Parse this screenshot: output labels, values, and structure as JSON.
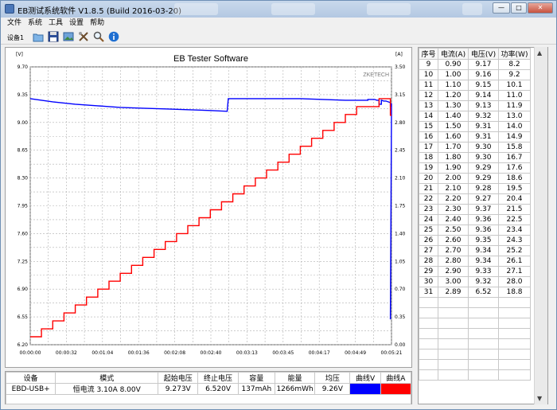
{
  "window": {
    "title": "EB测试系统软件 V1.8.5 (Build 2016-03-20)",
    "min_label": "—",
    "max_label": "□",
    "close_label": "✕"
  },
  "menu": [
    "文件",
    "系统",
    "工具",
    "设置",
    "帮助"
  ],
  "toolbar": {
    "device_label": "设备1",
    "icons": [
      "open-icon",
      "save-icon",
      "image-icon",
      "tools-icon",
      "zoom-icon",
      "info-icon"
    ]
  },
  "colors": {
    "voltage": "#0000ff",
    "current": "#ff0000",
    "grid": "#b0b0b0"
  },
  "chart_data": {
    "type": "line",
    "title": "EB Tester Software",
    "watermark": "ZKETECH",
    "left_unit": "[V]",
    "right_unit": "[A]",
    "y_left": {
      "ticks": [
        "9.70",
        "9.35",
        "9.00",
        "8.65",
        "8.30",
        "7.95",
        "7.60",
        "7.25",
        "6.90",
        "6.55",
        "6.20"
      ],
      "range": [
        6.2,
        9.7
      ]
    },
    "y_right": {
      "ticks": [
        "3.50",
        "3.15",
        "2.80",
        "2.45",
        "2.10",
        "1.75",
        "1.40",
        "1.05",
        "0.70",
        "0.35",
        "0.00"
      ],
      "range": [
        0.0,
        3.5
      ]
    },
    "x_ticks": [
      "00:00:00",
      "00:00:32",
      "00:01:04",
      "00:01:36",
      "00:02:08",
      "00:02:40",
      "00:03:13",
      "00:03:45",
      "00:04:17",
      "00:04:49",
      "00:05:21"
    ],
    "x_range_s": [
      0,
      321
    ],
    "series": [
      {
        "color": "#0000ff",
        "x": [
          0,
          10,
          20,
          40,
          60,
          80,
          100,
          120,
          140,
          160,
          175,
          176,
          200,
          240,
          260,
          280,
          300,
          310,
          312,
          300,
          304,
          306,
          308,
          310,
          312,
          314,
          316,
          318,
          320,
          321,
          310,
          320,
          321
        ],
        "y": [
          9.3,
          9.28,
          9.26,
          9.23,
          9.21,
          9.19,
          9.18,
          9.17,
          9.16,
          9.15,
          9.14,
          9.3,
          9.3,
          9.3,
          9.29,
          9.28,
          9.28,
          9.28,
          9.23,
          9.29,
          9.29,
          9.29,
          9.28,
          9.28,
          9.28,
          9.27,
          9.27,
          9.26,
          9.25,
          9.24,
          9.23,
          9.2,
          9.15
        ]
      },
      {
        "color": "#ff0000",
        "x": [
          0,
          10,
          20,
          30,
          40,
          50,
          60,
          70,
          80,
          90,
          100,
          110,
          120,
          130,
          140,
          150,
          160,
          170,
          180,
          190,
          200,
          210,
          220,
          230,
          240,
          250,
          260,
          270,
          280,
          290,
          300,
          310,
          320
        ],
        "y": [
          0.1,
          0.2,
          0.3,
          0.4,
          0.5,
          0.6,
          0.7,
          0.8,
          0.9,
          1.0,
          1.1,
          1.2,
          1.3,
          1.4,
          1.5,
          1.6,
          1.7,
          1.8,
          1.9,
          2.0,
          2.1,
          2.2,
          2.3,
          2.4,
          2.5,
          2.6,
          2.7,
          2.8,
          2.9,
          3.0,
          3.0,
          3.1,
          2.89
        ]
      }
    ]
  },
  "readings": {
    "headers": [
      "序号",
      "电流(A)",
      "电压(V)",
      "功率(W)"
    ],
    "rows": [
      [
        "9",
        "0.90",
        "9.17",
        "8.2"
      ],
      [
        "10",
        "1.00",
        "9.16",
        "9.2"
      ],
      [
        "11",
        "1.10",
        "9.15",
        "10.1"
      ],
      [
        "12",
        "1.20",
        "9.14",
        "11.0"
      ],
      [
        "13",
        "1.30",
        "9.13",
        "11.9"
      ],
      [
        "14",
        "1.40",
        "9.32",
        "13.0"
      ],
      [
        "15",
        "1.50",
        "9.31",
        "14.0"
      ],
      [
        "16",
        "1.60",
        "9.31",
        "14.9"
      ],
      [
        "17",
        "1.70",
        "9.30",
        "15.8"
      ],
      [
        "18",
        "1.80",
        "9.30",
        "16.7"
      ],
      [
        "19",
        "1.90",
        "9.29",
        "17.6"
      ],
      [
        "20",
        "2.00",
        "9.29",
        "18.6"
      ],
      [
        "21",
        "2.10",
        "9.28",
        "19.5"
      ],
      [
        "22",
        "2.20",
        "9.27",
        "20.4"
      ],
      [
        "23",
        "2.30",
        "9.37",
        "21.5"
      ],
      [
        "24",
        "2.40",
        "9.36",
        "22.5"
      ],
      [
        "25",
        "2.50",
        "9.36",
        "23.4"
      ],
      [
        "26",
        "2.60",
        "9.35",
        "24.3"
      ],
      [
        "27",
        "2.70",
        "9.34",
        "25.2"
      ],
      [
        "28",
        "2.80",
        "9.34",
        "26.1"
      ],
      [
        "29",
        "2.90",
        "9.33",
        "27.1"
      ],
      [
        "30",
        "3.00",
        "9.32",
        "28.0"
      ],
      [
        "31",
        "2.89",
        "6.52",
        "18.8"
      ]
    ]
  },
  "summary": {
    "headers": [
      "设备",
      "模式",
      "起始电压",
      "终止电压",
      "容量",
      "能量",
      "均压",
      "曲线V",
      "曲线A"
    ],
    "values": [
      "EBD-USB+",
      "恒电流  3.10A  8.00V",
      "9.273V",
      "6.520V",
      "137mAh",
      "1266mWh",
      "9.26V",
      "",
      ""
    ],
    "curve_v_color": "#0000ff",
    "curve_a_color": "#ff0000"
  }
}
